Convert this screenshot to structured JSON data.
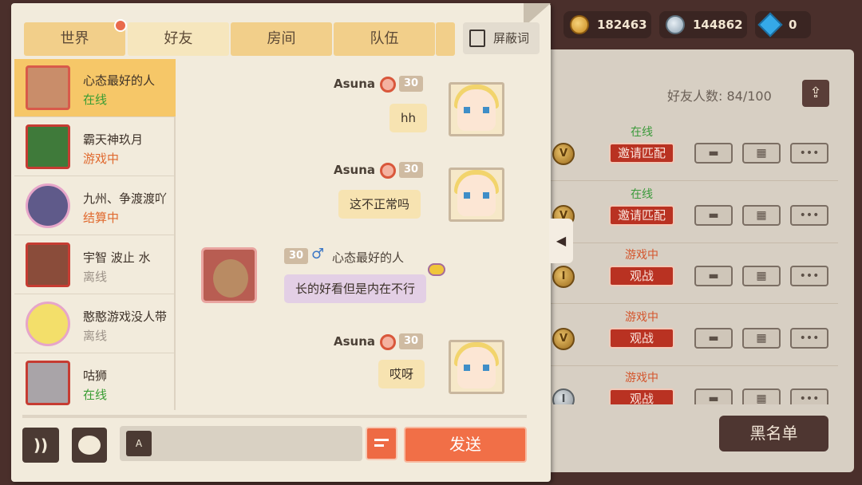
{
  "currency": {
    "gold": "182463",
    "silver": "144862",
    "gems": "0"
  },
  "tabs": [
    {
      "label": "世界",
      "has_dot": true
    },
    {
      "label": "好友",
      "active": true
    },
    {
      "label": "房间"
    },
    {
      "label": "队伍"
    }
  ],
  "block_words_label": "屏蔽词",
  "friend_list": [
    {
      "name": "心态最好的人",
      "status": "在线",
      "status_type": "online"
    },
    {
      "name": "霸天神玖月",
      "status": "游戏中",
      "status_type": "ingame"
    },
    {
      "name": "九州、争渡渡吖",
      "status": "结算中",
      "status_type": "settle"
    },
    {
      "name": "宇智 波止 水",
      "status": "离线",
      "status_type": "offline"
    },
    {
      "name": "憨憨游戏没人带",
      "status": "离线",
      "status_type": "offline"
    },
    {
      "name": "咕狮",
      "status": "在线",
      "status_type": "online"
    }
  ],
  "messages": [
    {
      "sender": "Asuna",
      "level": "30",
      "text": "hh"
    },
    {
      "sender": "Asuna",
      "level": "30",
      "text": "这不正常吗"
    },
    {
      "sender": "心态最好的人",
      "level": "30",
      "text": "长的好看但是内在不行"
    },
    {
      "sender": "Asuna",
      "level": "30",
      "text": "哎呀"
    }
  ],
  "input": {
    "placeholder": "",
    "send_label": "发送",
    "voice_label": "))",
    "mic_label": "A"
  },
  "friends_panel": {
    "count_label": "好友人数: 84/100",
    "rows": [
      {
        "vip": "V",
        "status": "在线",
        "status_type": "online",
        "action": "邀请匹配"
      },
      {
        "vip": "V",
        "status": "在线",
        "status_type": "online",
        "action": "邀请匹配"
      },
      {
        "vip": "I",
        "status": "游戏中",
        "status_type": "ingame",
        "action": "观战"
      },
      {
        "vip": "V",
        "status": "游戏中",
        "status_type": "ingame",
        "action": "观战"
      },
      {
        "vip": "I",
        "status": "游戏中",
        "status_type": "ingame",
        "action": "观战",
        "silver": true
      }
    ],
    "blacklist_label": "黑名单",
    "collapse_glyph": "◀"
  }
}
